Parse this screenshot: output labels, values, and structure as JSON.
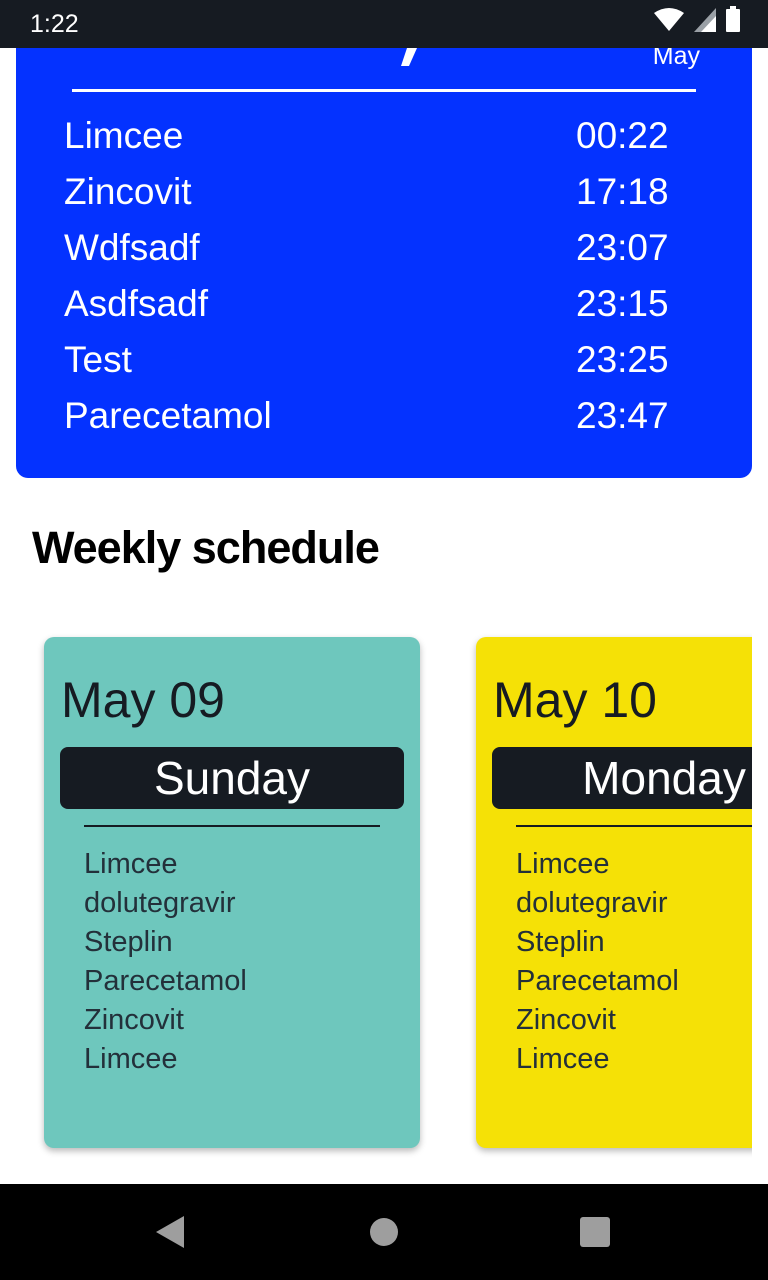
{
  "status_bar": {
    "time": "1:22"
  },
  "today_card": {
    "month": "May",
    "accent_color": "#0432ff",
    "items": [
      {
        "name": "Limcee",
        "time": "00:22"
      },
      {
        "name": "Zincovit",
        "time": "17:18"
      },
      {
        "name": "Wdfsadf",
        "time": "23:07"
      },
      {
        "name": "Asdfsadf",
        "time": "23:15"
      },
      {
        "name": "Test",
        "time": "23:25"
      },
      {
        "name": "Parecetamol",
        "time": "23:47"
      }
    ]
  },
  "weekly": {
    "title": "Weekly schedule",
    "days": [
      {
        "date": "May 09",
        "weekday": "Sunday",
        "color": "#6ec7bd",
        "meds": [
          "Limcee",
          "dolutegravir",
          "Steplin",
          "Parecetamol",
          "Zincovit",
          "Limcee"
        ]
      },
      {
        "date": "May 10",
        "weekday": "Monday",
        "color": "#f5e106",
        "meds": [
          "Limcee",
          "dolutegravir",
          "Steplin",
          "Parecetamol",
          "Zincovit",
          "Limcee"
        ]
      }
    ]
  },
  "icons": {
    "wifi": "wifi-icon",
    "signal": "signal-icon",
    "battery": "battery-icon",
    "back": "back-icon",
    "home": "home-icon",
    "recents": "recents-icon"
  }
}
